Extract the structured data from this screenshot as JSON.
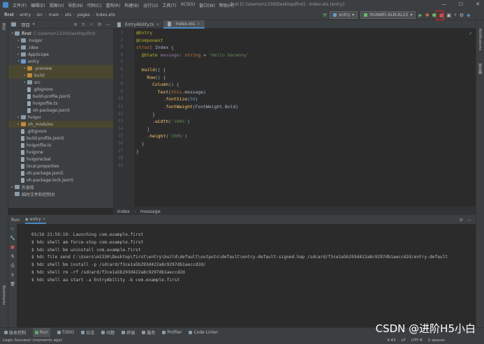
{
  "titlebar": {
    "menu": [
      "文件(F)",
      "编辑(E)",
      "视图(V)",
      "导航(N)",
      "代码(C)",
      "重构(R)",
      "构建(B)",
      "运行(U)",
      "工具(T)",
      "VCS(S)",
      "窗口(W)",
      "帮助(H)"
    ],
    "window_title": "first [C:\\Users\\m1330\\Desktop\\first] - Index.ets [entry]"
  },
  "breadcrumb": [
    "first",
    "entry",
    "src",
    "main",
    "ets",
    "pages",
    "Index.ets"
  ],
  "toolbar": {
    "module_select": "entry",
    "device_select": "HUAWEI ALN-AL10"
  },
  "project": {
    "header": "项目",
    "items": [
      {
        "label": "first",
        "path": "C:\\Users\\m1330\\Desktop\\first",
        "indent": 0,
        "arrow": "▾",
        "kind": "folder"
      },
      {
        "label": ".hvigor",
        "indent": 1,
        "arrow": "▸",
        "kind": "folder"
      },
      {
        "label": ".idea",
        "indent": 1,
        "arrow": "▸",
        "kind": "folder"
      },
      {
        "label": "AppScope",
        "indent": 1,
        "arrow": "▸",
        "kind": "folder"
      },
      {
        "label": "entry",
        "indent": 1,
        "arrow": "▾",
        "kind": "folder-blue"
      },
      {
        "label": ".preview",
        "indent": 2,
        "arrow": "▸",
        "kind": "folder-orange",
        "hl": true
      },
      {
        "label": "build",
        "indent": 2,
        "arrow": "▸",
        "kind": "folder-orange",
        "hl": true
      },
      {
        "label": "src",
        "indent": 2,
        "arrow": "▸",
        "kind": "folder"
      },
      {
        "label": ".gitignore",
        "indent": 2,
        "arrow": "",
        "kind": "file"
      },
      {
        "label": "build-profile.json5",
        "indent": 2,
        "arrow": "",
        "kind": "file"
      },
      {
        "label": "hvigorfile.ts",
        "indent": 2,
        "arrow": "",
        "kind": "file"
      },
      {
        "label": "oh-package.json5",
        "indent": 2,
        "arrow": "",
        "kind": "file"
      },
      {
        "label": "hvigor",
        "indent": 1,
        "arrow": "▸",
        "kind": "folder"
      },
      {
        "label": "oh_modules",
        "indent": 1,
        "arrow": "▸",
        "kind": "folder-orange",
        "hl": true
      },
      {
        "label": ".gitignore",
        "indent": 1,
        "arrow": "",
        "kind": "file"
      },
      {
        "label": "build-profile.json5",
        "indent": 1,
        "arrow": "",
        "kind": "file"
      },
      {
        "label": "hvigorfile.ts",
        "indent": 1,
        "arrow": "",
        "kind": "file"
      },
      {
        "label": "hvigorw",
        "indent": 1,
        "arrow": "",
        "kind": "file"
      },
      {
        "label": "hvigorw.bat",
        "indent": 1,
        "arrow": "",
        "kind": "file"
      },
      {
        "label": "local.properties",
        "indent": 1,
        "arrow": "",
        "kind": "file"
      },
      {
        "label": "oh-package.json5",
        "indent": 1,
        "arrow": "",
        "kind": "file"
      },
      {
        "label": "oh-package-lock.json5",
        "indent": 1,
        "arrow": "",
        "kind": "file"
      },
      {
        "label": "外部库",
        "indent": 0,
        "arrow": "▸",
        "kind": "folder"
      },
      {
        "label": "临时文件和控制台",
        "indent": 0,
        "arrow": "",
        "kind": "folder"
      }
    ]
  },
  "editor": {
    "tabs": [
      {
        "label": "EntryAbility.ts",
        "active": false
      },
      {
        "label": "Index.ets",
        "active": true
      }
    ],
    "line_numbers": [
      "1",
      "2",
      "3",
      "4",
      "5",
      "6",
      "7",
      "8",
      "9",
      "10",
      "11",
      "12",
      "13",
      "14",
      "15",
      "16",
      "17",
      "18",
      "19"
    ],
    "code": [
      [
        {
          "t": "@Entry",
          "c": "an"
        }
      ],
      [
        {
          "t": "@Component",
          "c": "an"
        }
      ],
      [
        {
          "t": "struct ",
          "c": "kw"
        },
        {
          "t": "Index {",
          "c": ""
        }
      ],
      [
        {
          "t": "  @State ",
          "c": "an"
        },
        {
          "t": "message",
          "c": "pr"
        },
        {
          "t": ": ",
          "c": ""
        },
        {
          "t": "string",
          "c": "kw"
        },
        {
          "t": " = ",
          "c": ""
        },
        {
          "t": "'Hello Harmony'",
          "c": "st"
        }
      ],
      [],
      [
        {
          "t": "  ",
          "c": ""
        },
        {
          "t": "build",
          "c": "fn"
        },
        {
          "t": "() {",
          "c": ""
        }
      ],
      [
        {
          "t": "    ",
          "c": ""
        },
        {
          "t": "Row",
          "c": "fn"
        },
        {
          "t": "() {",
          "c": ""
        }
      ],
      [
        {
          "t": "      ",
          "c": ""
        },
        {
          "t": "Column",
          "c": "fn"
        },
        {
          "t": "() {",
          "c": ""
        }
      ],
      [
        {
          "t": "        ",
          "c": ""
        },
        {
          "t": "Text",
          "c": "fn"
        },
        {
          "t": "(",
          "c": ""
        },
        {
          "t": "this",
          "c": "kw"
        },
        {
          "t": ".message)",
          "c": ""
        }
      ],
      [
        {
          "t": "          .",
          "c": ""
        },
        {
          "t": "fontSize",
          "c": "fn"
        },
        {
          "t": "(",
          "c": ""
        },
        {
          "t": "50",
          "c": "nm"
        },
        {
          "t": ")",
          "c": ""
        }
      ],
      [
        {
          "t": "          .",
          "c": ""
        },
        {
          "t": "fontWeight",
          "c": "fn"
        },
        {
          "t": "(FontWeight.Bold)",
          "c": ""
        }
      ],
      [
        {
          "t": "      }",
          "c": ""
        }
      ],
      [
        {
          "t": "      .",
          "c": ""
        },
        {
          "t": "width",
          "c": "fn"
        },
        {
          "t": "(",
          "c": ""
        },
        {
          "t": "'100%'",
          "c": "st"
        },
        {
          "t": ")",
          "c": ""
        }
      ],
      [
        {
          "t": "    }",
          "c": ""
        }
      ],
      [
        {
          "t": "    .",
          "c": ""
        },
        {
          "t": "height",
          "c": "fn"
        },
        {
          "t": "(",
          "c": ""
        },
        {
          "t": "'100%'",
          "c": "st"
        },
        {
          "t": ")",
          "c": ""
        }
      ],
      [
        {
          "t": "  }",
          "c": ""
        }
      ],
      [
        {
          "t": "}",
          "c": ""
        }
      ],
      [],
      []
    ],
    "footer": [
      "Index",
      "message"
    ]
  },
  "run": {
    "title": "Run:",
    "config": "entry",
    "lines": [
      "03/26 21:59:19: Launching com.example.first",
      "$ hdc shell am force-stop com.example.first",
      "$ hdc shell bm uninstall com.example.first",
      "$ hdc file send C:\\Users\\m1330\\Desktop\\first\\entry\\build\\default\\outputs\\default\\entry-default-signed.hap /sdcard/f3ce1a5b293d422a8c9297db1aeccd2d/entry-default",
      "$ hdc shell bm install -p /sdcard/f3ce1a5b293d422a8c9297db1aeccd2d/",
      "$ hdc shell rm -rf /sdcard/f3ce1a5b293d422a8c9297db1aeccd2d",
      "$ hdc shell aa start -a EntryAbility -b com.example.first"
    ]
  },
  "bottom_tabs": [
    "版本控制",
    "Run",
    "TODO",
    "日志",
    "问题",
    "终端",
    "服务",
    "Profiler",
    "Code Linter"
  ],
  "status": {
    "left": "Login Success! (moments ago)",
    "right": [
      "4:43",
      "LF",
      "UTF-8",
      "2 spaces"
    ]
  },
  "side_labels": {
    "left_top": "项目",
    "left_bottom": "Bookmarks",
    "right_top": "Notifications",
    "right_second": "预览器"
  },
  "watermark": "CSDN @进阶H5小白",
  "colors": {
    "highlight_box": "#e02020",
    "accent": "#4a88c7"
  }
}
